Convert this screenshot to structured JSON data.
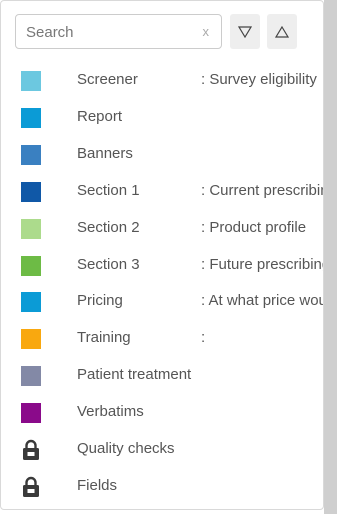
{
  "search": {
    "placeholder": "Search",
    "value": "",
    "clear_label": "x"
  },
  "sort": {
    "descending_icon": "triangle-down-icon",
    "ascending_icon": "triangle-up-icon"
  },
  "items": [
    {
      "label": "Screener",
      "desc": ": Survey eligibility",
      "icon": "swatch",
      "color": "#6cc8e0"
    },
    {
      "label": "Report",
      "desc": "",
      "icon": "swatch",
      "color": "#0b9bd6"
    },
    {
      "label": "Banners",
      "desc": "",
      "icon": "swatch",
      "color": "#3a80c1"
    },
    {
      "label": "Section 1",
      "desc": ": Current prescribing",
      "icon": "swatch",
      "color": "#1058a7"
    },
    {
      "label": "Section 2",
      "desc": ": Product profile",
      "icon": "swatch",
      "color": "#acdb8c"
    },
    {
      "label": "Section 3",
      "desc": ": Future prescribing",
      "icon": "swatch",
      "color": "#6dbb45"
    },
    {
      "label": "Pricing",
      "desc": ": At what price would",
      "icon": "swatch",
      "color": "#0b9bd6"
    },
    {
      "label": "Training",
      "desc": ":",
      "icon": "swatch",
      "color": "#f9a80f"
    },
    {
      "label": "Patient treatment",
      "desc": "",
      "icon": "swatch",
      "color": "#8389a6"
    },
    {
      "label": "Verbatims",
      "desc": "",
      "icon": "swatch",
      "color": "#8a0a8a"
    },
    {
      "label": "Quality checks",
      "desc": "",
      "icon": "lock-icon",
      "color": "#3a3a3a"
    },
    {
      "label": "Fields",
      "desc": "",
      "icon": "lock-icon",
      "color": "#3a3a3a"
    }
  ]
}
